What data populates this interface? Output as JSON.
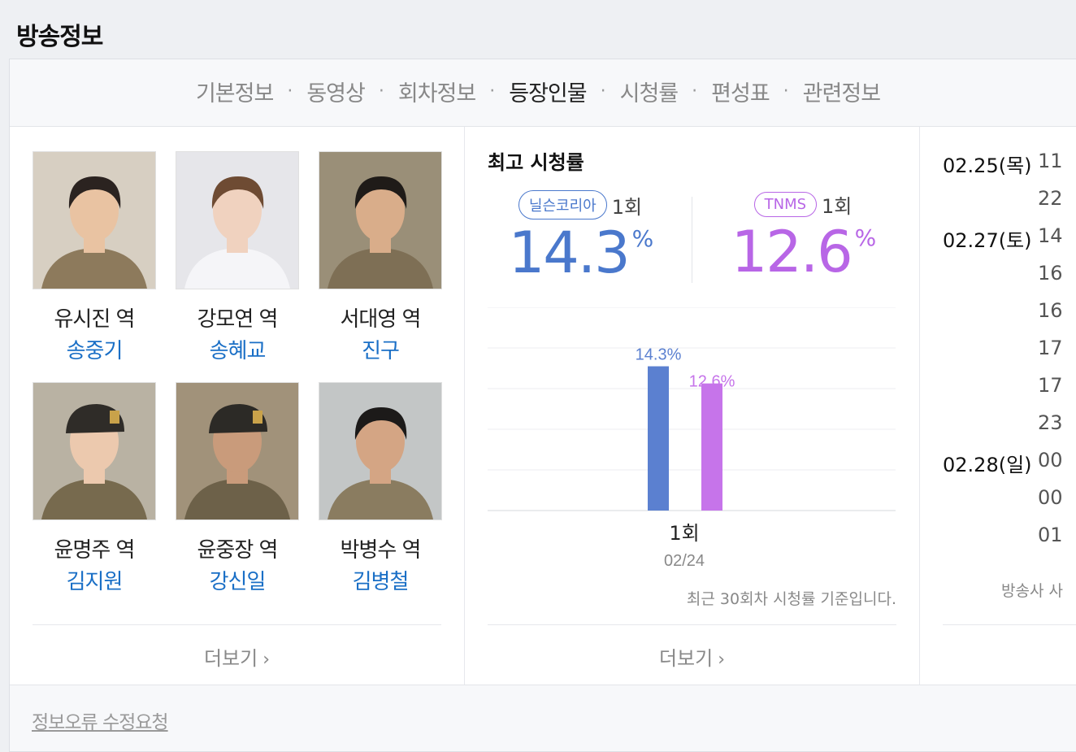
{
  "page": {
    "title": "방송정보"
  },
  "tabs": [
    {
      "label": "기본정보"
    },
    {
      "label": "동영상"
    },
    {
      "label": "회차정보"
    },
    {
      "label": "등장인물"
    },
    {
      "label": "시청률"
    },
    {
      "label": "편성표"
    },
    {
      "label": "관련정보"
    }
  ],
  "active_tab": "등장인물",
  "cast": [
    {
      "role": "유시진 역",
      "actor": "송중기"
    },
    {
      "role": "강모연 역",
      "actor": "송혜교"
    },
    {
      "role": "서대영 역",
      "actor": "진구"
    },
    {
      "role": "윤명주 역",
      "actor": "김지원"
    },
    {
      "role": "윤중장 역",
      "actor": "강신일"
    },
    {
      "role": "박병수 역",
      "actor": "김병철"
    }
  ],
  "cast_more": "더보기",
  "rating": {
    "title": "최고 시청률",
    "sources": [
      {
        "name": "닐슨코리아",
        "episode": "1회",
        "value": "14.3",
        "unit": "%",
        "color": "#4a78cc"
      },
      {
        "name": "TNMS",
        "episode": "1회",
        "value": "12.6",
        "unit": "%",
        "color": "#b866e6"
      }
    ],
    "more": "더보기",
    "footnote": "최근 30회차 시청률 기준입니다."
  },
  "chart_data": {
    "type": "bar",
    "categories": [
      "1회"
    ],
    "category_dates": [
      "02/24"
    ],
    "series": [
      {
        "name": "닐슨코리아",
        "values": [
          14.3
        ],
        "color": "#5b80d0"
      },
      {
        "name": "TNMS",
        "values": [
          12.6
        ],
        "color": "#c674ea"
      }
    ],
    "data_labels": [
      "14.3%",
      "12.6%"
    ],
    "grid": true
  },
  "schedule": [
    {
      "date": "02.25(목)",
      "times": [
        "11",
        "22"
      ]
    },
    {
      "date": "02.27(토)",
      "times": [
        "14",
        "16",
        "16",
        "17",
        "17",
        "23"
      ]
    },
    {
      "date": "02.28(일)",
      "times": [
        "00",
        "00",
        "01"
      ]
    }
  ],
  "schedule_note": "방송사 사",
  "footer": {
    "report_link": "정보오류 수정요청"
  }
}
